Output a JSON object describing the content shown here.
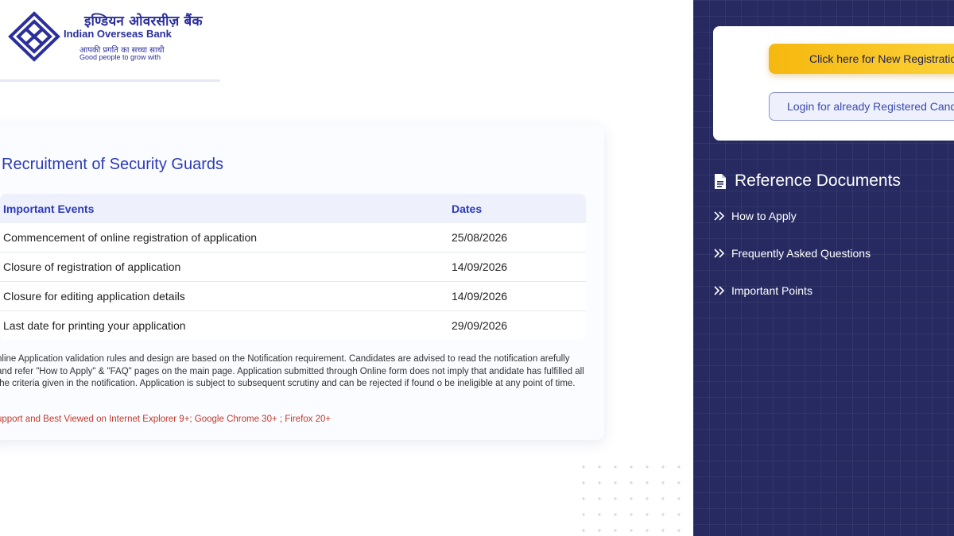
{
  "header": {
    "bank_name_hindi": "इण्डियन ओवरसीज़ बैंक",
    "bank_name_english": "Indian Overseas Bank",
    "tagline_hindi": "आपकी प्रगति का सच्चा साथी",
    "tagline_english": "Good people to grow with",
    "logo_color": "#2b2f9c"
  },
  "main": {
    "title": "Recruitment of Security Guards",
    "table": {
      "headers": [
        "Important Events",
        "Dates"
      ],
      "rows": [
        {
          "event": "Commencement of online registration of application",
          "date": "25/08/2026"
        },
        {
          "event": "Closure of registration of application",
          "date": "14/09/2026"
        },
        {
          "event": "Closure for editing application details",
          "date": "14/09/2026"
        },
        {
          "event": "Last date for printing your application",
          "date": "29/09/2026"
        }
      ]
    },
    "notice": "nline Application validation rules and design are based on the Notification requirement. Candidates are advised to read the notification arefully and refer \"How to Apply\" & \"FAQ\" pages on the main page. Application submitted through Online form does not imply that andidate has fulfilled all the criteria given in the notification. Application is subject to subsequent scrutiny and can be rejected if found o be ineligible at any point of time.",
    "browser_support": "upport and Best Viewed on Internet Explorer 9+; Google Chrome 30+ ; Firefox 20+"
  },
  "sidebar": {
    "register_button": "Click here for New Registration",
    "login_button": "Login for already Registered Candidates",
    "reference_heading": "Reference Documents",
    "links": [
      {
        "label": "How to Apply",
        "icon": "double-chevron-right-icon"
      },
      {
        "label": "Frequently Asked Questions",
        "icon": "double-chevron-right-icon"
      },
      {
        "label": "Important Points",
        "icon": "double-chevron-right-icon"
      }
    ]
  },
  "colors": {
    "sidebar_bg": "#262a61",
    "accent_blue": "#2b3ab8",
    "register_yellow": "#f5b80f",
    "warning_red": "#c0392b"
  }
}
